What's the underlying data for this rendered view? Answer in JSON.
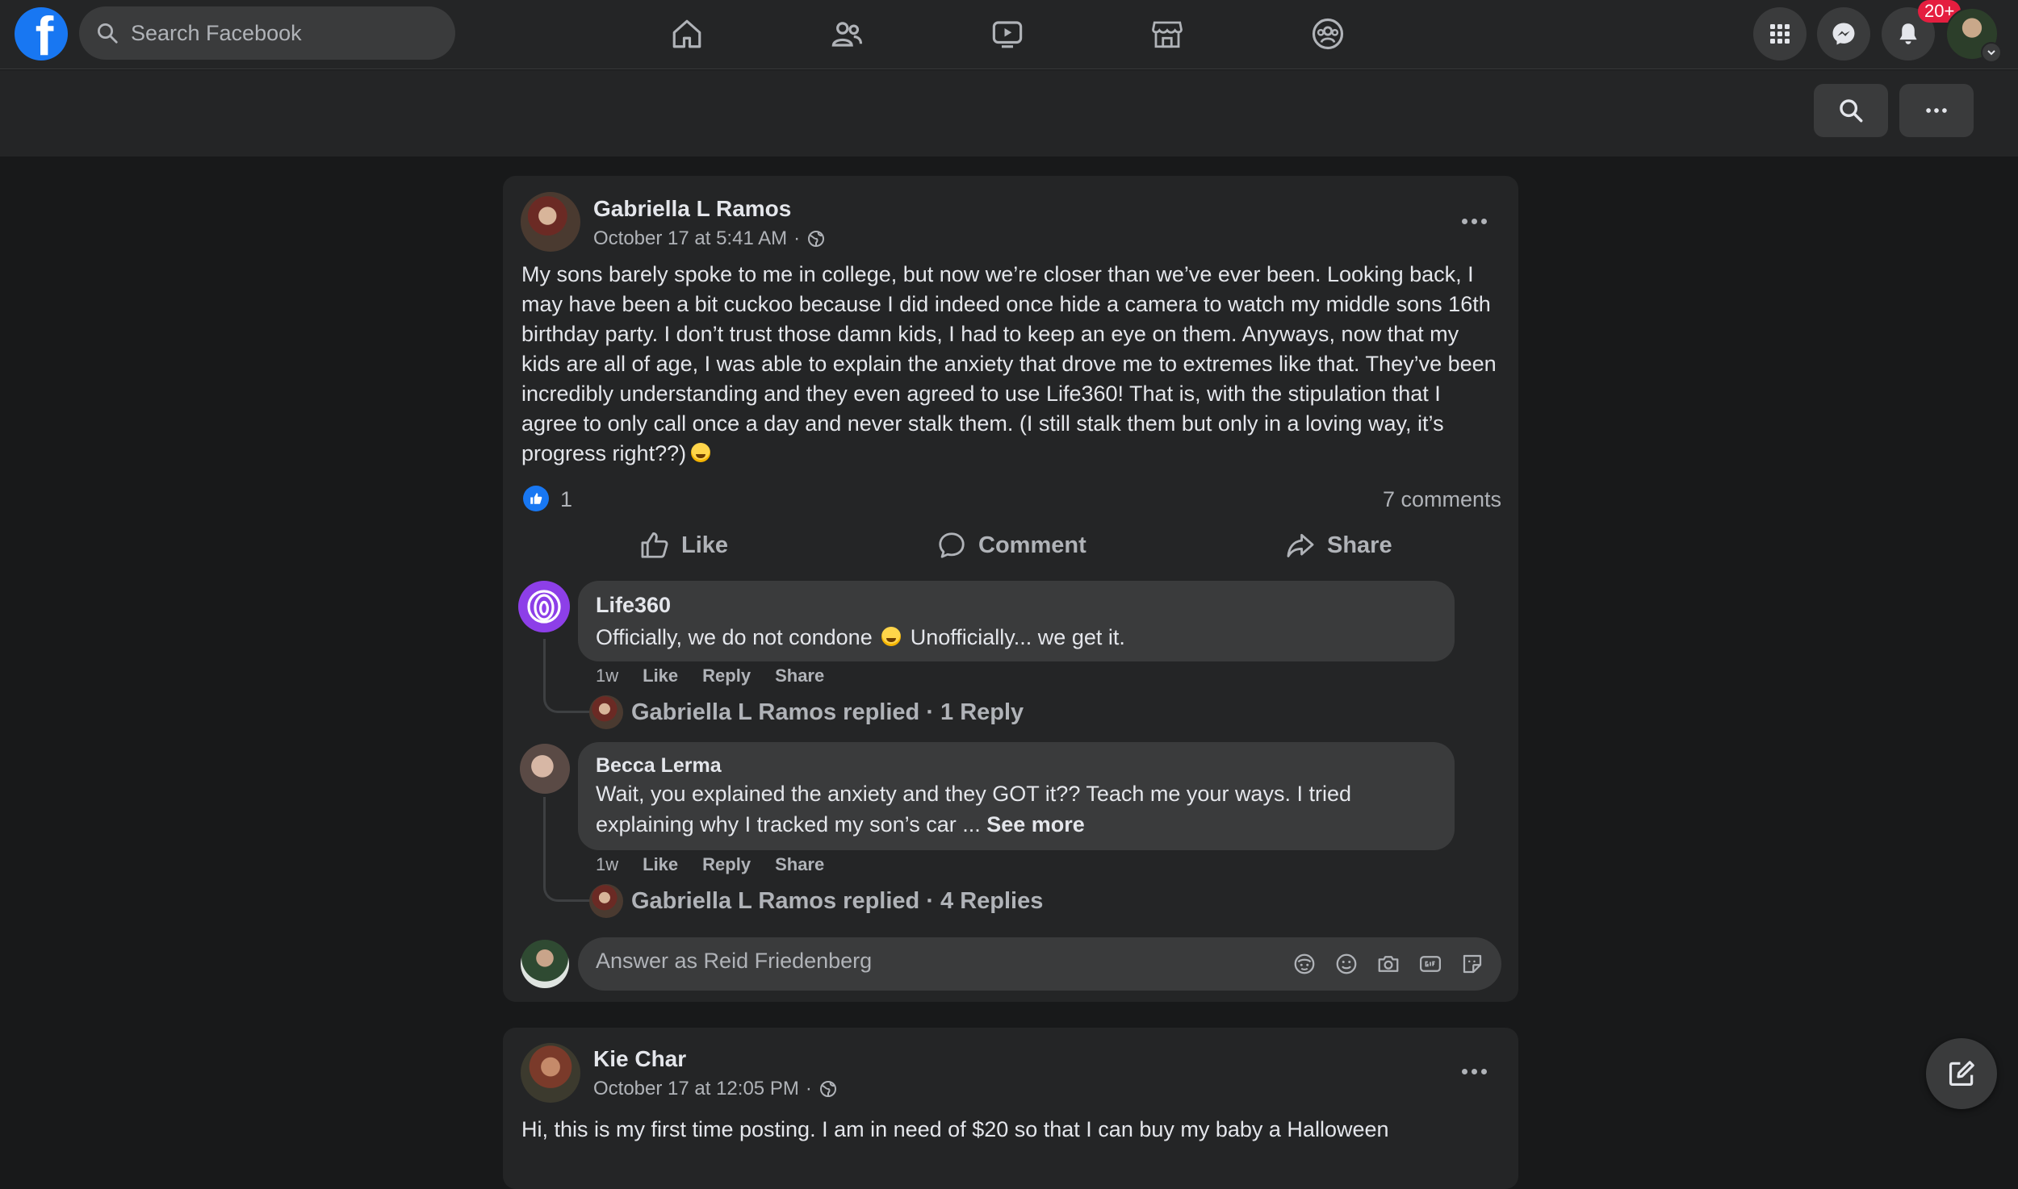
{
  "nav": {
    "search_placeholder": "Search Facebook",
    "notification_badge": "20+"
  },
  "posts": [
    {
      "author": "Gabriella L Ramos",
      "timestamp": "October 17 at 5:41 AM",
      "privacy": "globe-icon",
      "text": "My sons barely spoke to me in college, but now we’re closer than we’ve ever been. Looking back, I may have been a bit cuckoo because I did indeed once hide a camera to watch my middle sons 16th birthday party. I don’t trust those damn kids, I had to keep an eye on them. Anyways, now that my kids are all of age, I was able to explain the anxiety that drove me to extremes like that. They’ve been incredibly understanding and they even agreed to use Life360! That is, with the stipulation that I agree to only call once a day and never stalk them. (I still stalk them but only in a loving way, it’s progress right??)",
      "reaction_count": "1",
      "comment_count": "7 comments",
      "actions": {
        "like": "Like",
        "comment": "Comment",
        "share": "Share"
      },
      "comments": [
        {
          "author": "Life360",
          "text_before_emoji": "Officially, we do not condone",
          "text_after_emoji": "Unofficially... we get it.",
          "time": "1w",
          "like": "Like",
          "reply": "Reply",
          "share": "Share",
          "replies_summary": "Gabriella L Ramos replied · 1 Reply"
        },
        {
          "author": "Becca Lerma",
          "text": "Wait, you explained the anxiety and they GOT it?? Teach me your ways. I tried explaining why I tracked my son’s car ...",
          "see_more": "See more",
          "time": "1w",
          "like": "Like",
          "reply": "Reply",
          "share": "Share",
          "replies_summary": "Gabriella L Ramos replied · 4 Replies"
        }
      ],
      "answer_placeholder": "Answer as Reid Friedenberg"
    },
    {
      "author": "Kie Char",
      "timestamp": "October 17 at 12:05 PM",
      "privacy": "globe-icon",
      "text": "Hi, this is my first time posting. I am in need of $20 so that I can buy my baby a Halloween"
    }
  ],
  "colors": {
    "background": "#18191a",
    "surface": "#242526",
    "input": "#3a3b3c",
    "accent": "#1877f2",
    "badge": "#e41e3f",
    "life360": "#8d3fe8"
  }
}
